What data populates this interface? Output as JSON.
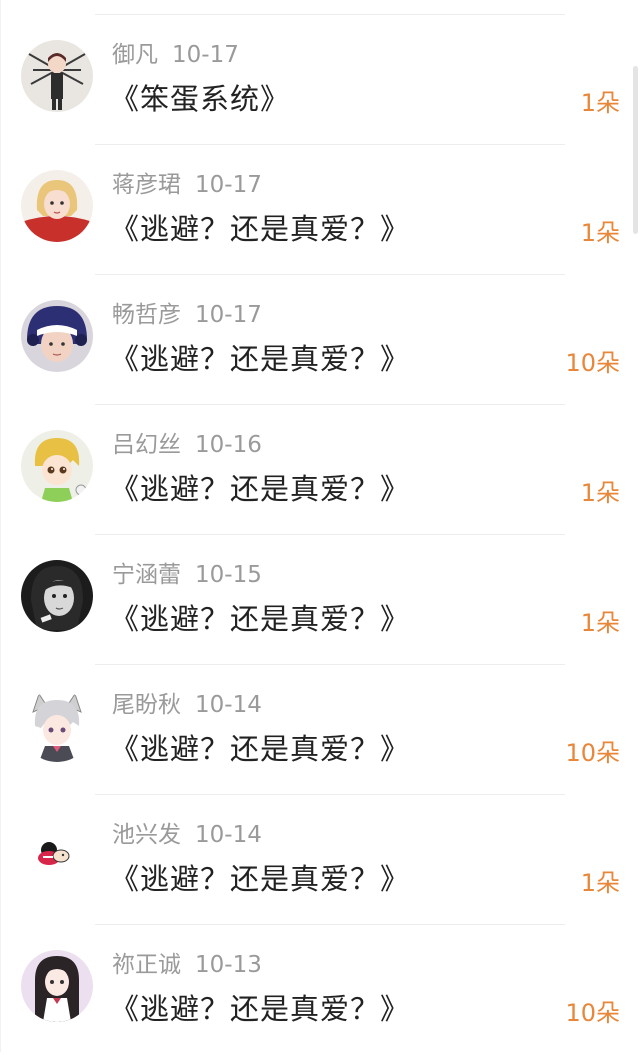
{
  "rows": [
    {
      "user": "御凡",
      "date": "10-17",
      "title": "《笨蛋系统》",
      "count": "1朵",
      "avatar": "avatar-dark-wings"
    },
    {
      "user": "蒋彦珺",
      "date": "10-17",
      "title": "《逃避？还是真爱？》",
      "count": "1朵",
      "avatar": "avatar-blonde-red"
    },
    {
      "user": "畅哲彦",
      "date": "10-17",
      "title": "《逃避？还是真爱？》",
      "count": "10朵",
      "avatar": "avatar-helmet"
    },
    {
      "user": "吕幻丝",
      "date": "10-16",
      "title": "《逃避？还是真爱？》",
      "count": "1朵",
      "avatar": "avatar-chibi-blonde"
    },
    {
      "user": "宁涵蕾",
      "date": "10-15",
      "title": "《逃避？还是真爱？》",
      "count": "1朵",
      "avatar": "avatar-bw-photo"
    },
    {
      "user": "尾盼秋",
      "date": "10-14",
      "title": "《逃避？还是真爱？》",
      "count": "10朵",
      "avatar": "avatar-cat-boy"
    },
    {
      "user": "池兴发",
      "date": "10-14",
      "title": "《逃避？还是真爱？》",
      "count": "1朵",
      "avatar": "avatar-small-cartoon"
    },
    {
      "user": "祢正诚",
      "date": "10-13",
      "title": "《逃避？还是真爱？》",
      "count": "10朵",
      "avatar": "avatar-anime-girl"
    }
  ],
  "colors": {
    "name": "#9a9a9a",
    "title": "#222222",
    "count": "#e8873a",
    "divider": "#ededed"
  }
}
